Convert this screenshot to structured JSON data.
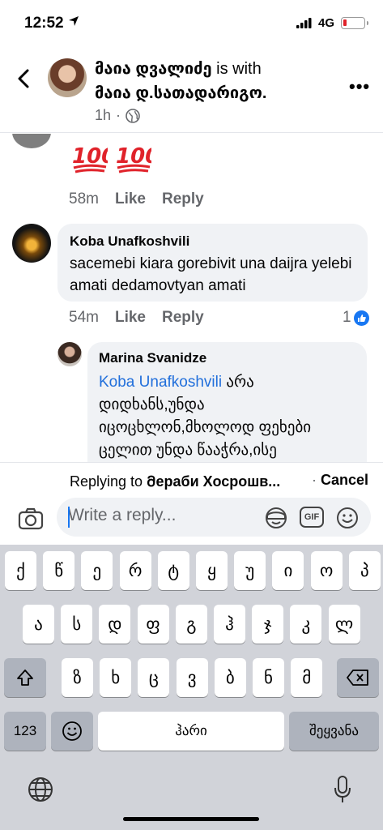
{
  "status_bar": {
    "time": "12:52",
    "network": "4G"
  },
  "post": {
    "author": "მაია დვალიძე",
    "with_text": "is with",
    "tagged": "მაია დ.სათადარიგო.",
    "time": "1h",
    "dot": "·"
  },
  "comments": [
    {
      "text": "💯💯",
      "time": "58m",
      "like": "Like",
      "reply": "Reply"
    },
    {
      "author": "Koba Unafkoshvili",
      "text": "sacemebi kiara gorebivit una daijra yelebi amati dedamovtyan amati",
      "time": "54m",
      "like": "Like",
      "reply": "Reply",
      "reactions": "1"
    }
  ],
  "reply": {
    "author": "Marina Svanidze",
    "mention": "Koba Unafkoshvili",
    "text": " არა დიდხანს,უნდა იცოცხლონ,მხოლოდ ფეხები ცელით უნდა წააჭრა,ისე"
  },
  "replying_bar": {
    "lead": "Replying to ",
    "name": "Მераби Хосрошв...",
    "sep": " · ",
    "cancel": "Cancel"
  },
  "composer": {
    "placeholder": "Write a reply...",
    "gif": "GIF"
  },
  "keyboard": {
    "row1": [
      "ქ",
      "წ",
      "ე",
      "რ",
      "ტ",
      "ყ",
      "უ",
      "ი",
      "ო",
      "პ"
    ],
    "row2": [
      "ა",
      "ს",
      "დ",
      "ფ",
      "გ",
      "ჰ",
      "ჯ",
      "კ",
      "ლ"
    ],
    "row3": [
      "ზ",
      "ხ",
      "ც",
      "ვ",
      "ბ",
      "ნ",
      "მ"
    ],
    "numbers": "123",
    "space": "ჰარი",
    "return": "შეყვანა"
  },
  "colors": {
    "accent": "#1877f2",
    "mention": "#216fdb",
    "emoji100": "#e0222a"
  }
}
